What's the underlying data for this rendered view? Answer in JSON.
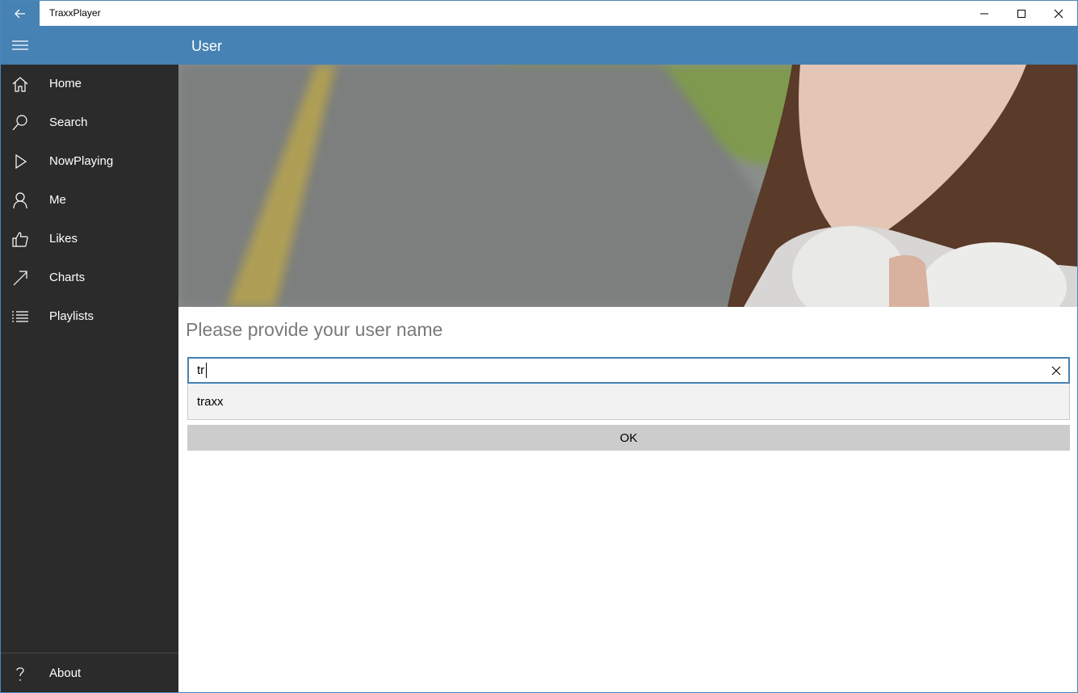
{
  "window": {
    "title": "TraxxPlayer"
  },
  "header": {
    "page_title": "User"
  },
  "sidebar": {
    "items": [
      {
        "label": "Home",
        "icon": "home-icon"
      },
      {
        "label": "Search",
        "icon": "search-icon"
      },
      {
        "label": "NowPlaying",
        "icon": "play-icon"
      },
      {
        "label": "Me",
        "icon": "user-icon"
      },
      {
        "label": "Likes",
        "icon": "thumbs-up-icon"
      },
      {
        "label": "Charts",
        "icon": "trend-arrow-icon"
      },
      {
        "label": "Playlists",
        "icon": "list-icon"
      }
    ],
    "footer_item": {
      "label": "About",
      "icon": "help-icon"
    }
  },
  "main": {
    "prompt": "Please provide your user name",
    "username_input": {
      "value": "tr"
    },
    "suggestions": [
      "traxx"
    ],
    "ok_label": "OK"
  },
  "colors": {
    "accent": "#4682b4",
    "sidebar_bg": "#2b2b2b",
    "button_bg": "#cccccc"
  }
}
